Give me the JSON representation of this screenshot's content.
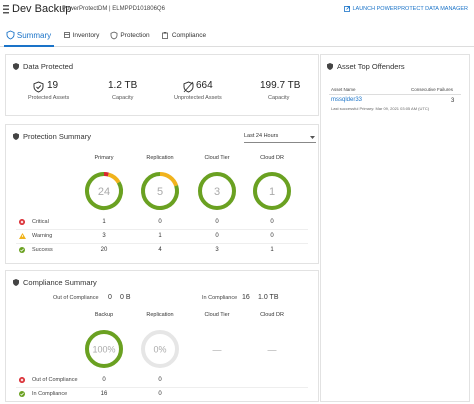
{
  "header": {
    "title": "Dev Backup",
    "subtitle": "PowerProtectDM | ELMPPD101806Q6",
    "launch_link": "LAUNCH POWERPROTECT DATA MANAGER"
  },
  "tabs": [
    {
      "label": "Summary"
    },
    {
      "label": "Inventory"
    },
    {
      "label": "Protection"
    },
    {
      "label": "Compliance"
    }
  ],
  "data_protected": {
    "title": "Data Protected",
    "protected_assets": {
      "value": "19",
      "label": "Protected Assets"
    },
    "capacity1": {
      "value": "1.2 TB",
      "label": "Capacity"
    },
    "unprotected_assets": {
      "value": "664",
      "label": "Unprotected Assets"
    },
    "capacity2": {
      "value": "199.7 TB",
      "label": "Capacity"
    }
  },
  "protection_summary": {
    "title": "Protection Summary",
    "range": "Last 24 Hours",
    "columns": [
      "Primary",
      "Replication",
      "Cloud Tier",
      "Cloud DR"
    ],
    "donuts": [
      {
        "value": "24",
        "success": 20,
        "warning": 3,
        "critical": 1
      },
      {
        "value": "5",
        "success": 4,
        "warning": 1,
        "critical": 0
      },
      {
        "value": "3",
        "success": 3,
        "warning": 0,
        "critical": 0
      },
      {
        "value": "1",
        "success": 1,
        "warning": 0,
        "critical": 0
      }
    ],
    "rows": [
      {
        "label": "Critical",
        "values": [
          "1",
          "0",
          "0",
          "0"
        ]
      },
      {
        "label": "Warning",
        "values": [
          "3",
          "1",
          "0",
          "0"
        ]
      },
      {
        "label": "Success",
        "values": [
          "20",
          "4",
          "3",
          "1"
        ]
      }
    ]
  },
  "compliance_summary": {
    "title": "Compliance Summary",
    "out_label": "Out of Compliance",
    "out_count": "0",
    "out_size": "0 B",
    "in_label": "In Compliance",
    "in_count": "16",
    "in_size": "1.0 TB",
    "columns": [
      "Backup",
      "Replication",
      "Cloud Tier",
      "Cloud DR"
    ],
    "donuts": [
      {
        "value": "100%",
        "fill": 1.0
      },
      {
        "value": "0%",
        "fill": 0
      },
      {
        "value": "—",
        "fill": 0
      },
      {
        "value": "—",
        "fill": 0
      }
    ],
    "rows": [
      {
        "label": "Out of Compliance",
        "values": [
          "0",
          "0"
        ]
      },
      {
        "label": "In Compliance",
        "values": [
          "16",
          "0"
        ]
      }
    ]
  },
  "offenders": {
    "title": "Asset Top Offenders",
    "col_name": "Asset Name",
    "col_failures": "Consecutive Failures",
    "item_name": "mssqlder33",
    "item_detail": "Last successful Primary: Mar 09, 2021 03:05 AM (UTC)",
    "item_failures": "3"
  },
  "colors": {
    "accent": "#1a73c8",
    "success": "#6aa121",
    "warning": "#f1b31c",
    "critical": "#d9282f",
    "track": "#e6e6e6"
  }
}
